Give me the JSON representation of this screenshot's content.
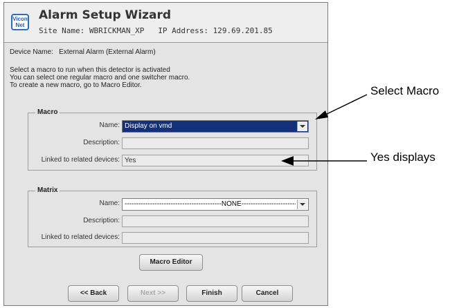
{
  "header": {
    "logo_text": "Vicon Net",
    "title": "Alarm Setup Wizard",
    "site_label": "Site Name: WBRICKMAN_XP",
    "ip_label": "IP Address: 129.69.201.85"
  },
  "device": {
    "label": "Device Name:",
    "value": "External Alarm (External Alarm)"
  },
  "instructions": [
    "Select a macro to run when this detector is activated",
    "You can select one regular macro and one switcher macro.",
    "To create a new macro, go to Macro Editor."
  ],
  "macro_group": {
    "title": "Macro",
    "name_label": "Name:",
    "name_value": "Display on vmd",
    "description_label": "Description:",
    "description_value": "",
    "linked_label": "Linked to related devices:",
    "linked_value": "Yes"
  },
  "matrix_group": {
    "title": "Matrix",
    "name_label": "Name:",
    "name_value": "------------------------------------------NONE------------------------------------------",
    "description_label": "Description:",
    "description_value": "",
    "linked_label": "Linked to related devices:",
    "linked_value": ""
  },
  "buttons": {
    "macro_editor": "Macro Editor",
    "back": "<< Back",
    "next": "Next >>",
    "finish": "Finish",
    "cancel": "Cancel"
  },
  "callouts": {
    "select_macro": "Select Macro",
    "yes_displays": "Yes displays"
  },
  "colors": {
    "selection": "#13307a",
    "dialog_bg": "#e4e4e4"
  }
}
